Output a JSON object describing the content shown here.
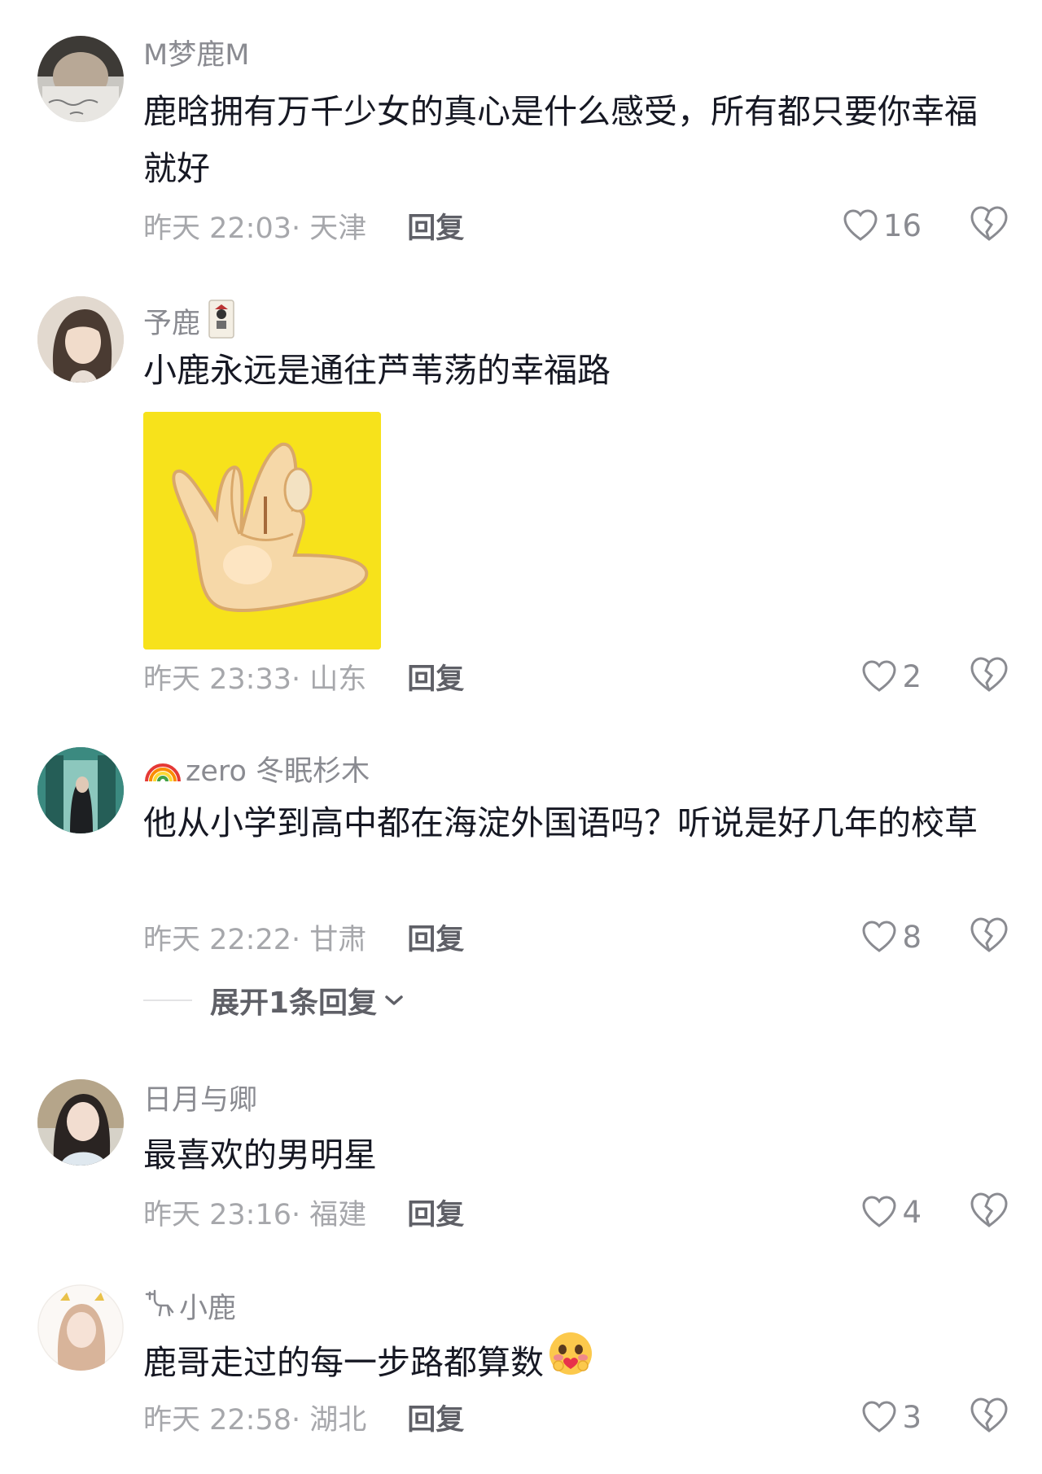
{
  "comments": [
    {
      "username": "M梦鹿M",
      "text": "鹿晗拥有万千少女的真心是什么感受，所有都只要你幸福就好",
      "time": "昨天 22:03· 天津",
      "reply_label": "回复",
      "likes": "16"
    },
    {
      "username": "予鹿",
      "text": "小鹿永远是通往芦苇荡的幸福路",
      "time": "昨天 23:33· 山东",
      "reply_label": "回复",
      "likes": "2"
    },
    {
      "username": "zero 冬眠杉木",
      "text": "他从小学到高中都在海淀外国语吗？听说是好几年的校草",
      "time": "昨天 22:22· 甘肃",
      "reply_label": "回复",
      "likes": "8",
      "expand_label": "展开1条回复"
    },
    {
      "username": "日月与卿",
      "text": "最喜欢的男明星",
      "time": "昨天 23:16· 福建",
      "reply_label": "回复",
      "likes": "4"
    },
    {
      "username": "小鹿",
      "text": "鹿哥走过的每一步路都算数",
      "time": "昨天 22:58· 湖北",
      "reply_label": "回复",
      "likes": "3"
    }
  ],
  "colors": {
    "username": "#8a8b91",
    "text": "#161823",
    "meta": "#a6a7ab",
    "sticker_bg": "#f7e21b"
  },
  "icons": {
    "like": "heart-outline-icon",
    "dislike": "broken-heart-icon",
    "expand": "chevron-down-icon"
  }
}
